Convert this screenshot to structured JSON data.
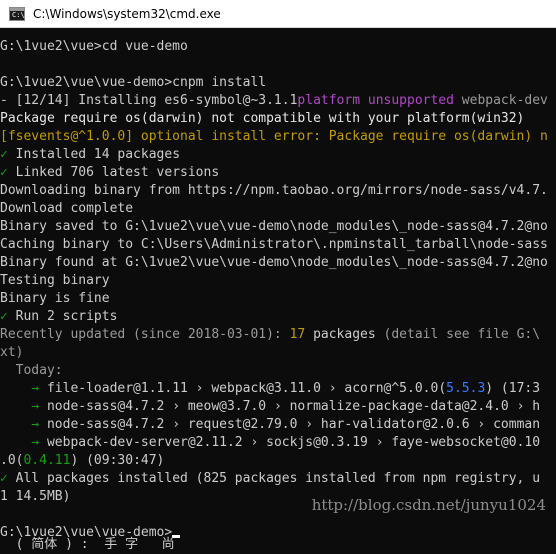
{
  "window": {
    "title": "C:\\Windows\\system32\\cmd.exe",
    "icon": "cmd-icon"
  },
  "console": {
    "lines": [
      {
        "segments": [
          {
            "text": "G:\\1vue2\\vue>cd vue-demo",
            "color": "default"
          }
        ]
      },
      {
        "segments": [
          {
            "text": "",
            "color": "default"
          }
        ]
      },
      {
        "segments": [
          {
            "text": "G:\\1vue2\\vue\\vue-demo>cnpm install",
            "color": "default"
          }
        ]
      },
      {
        "segments": [
          {
            "text": "- [12/14] Installing es6-symbol@~3.1.1",
            "color": "default"
          },
          {
            "text": "platform unsupported",
            "color": "magenta"
          },
          {
            "text": " webpack-dev",
            "color": "gray"
          }
        ]
      },
      {
        "segments": [
          {
            "text": "Package require os(darwin) not compatible with your platform(win32)",
            "color": "white"
          }
        ]
      },
      {
        "segments": [
          {
            "text": "[fsevents@^1.0.0] optional install error: Package require os(darwin) n",
            "color": "yellow"
          }
        ]
      },
      {
        "segments": [
          {
            "text": "✓",
            "color": "green"
          },
          {
            "text": " Installed 14 packages",
            "color": "default"
          }
        ]
      },
      {
        "segments": [
          {
            "text": "✓",
            "color": "green"
          },
          {
            "text": " Linked 706 latest versions",
            "color": "default"
          }
        ]
      },
      {
        "segments": [
          {
            "text": "Downloading binary from https://npm.taobao.org/mirrors/node-sass/v4.7.",
            "color": "default"
          }
        ]
      },
      {
        "segments": [
          {
            "text": "Download complete",
            "color": "default"
          }
        ]
      },
      {
        "segments": [
          {
            "text": "Binary saved to G:\\1vue2\\vue\\vue-demo\\node_modules\\_node-sass@4.7.2@no",
            "color": "default"
          }
        ]
      },
      {
        "segments": [
          {
            "text": "Caching binary to C:\\Users\\Administrator\\.npminstall_tarball\\node-sass",
            "color": "default"
          }
        ]
      },
      {
        "segments": [
          {
            "text": "Binary found at G:\\1vue2\\vue\\vue-demo\\node_modules\\_node-sass@4.7.2@no",
            "color": "default"
          }
        ]
      },
      {
        "segments": [
          {
            "text": "Testing binary",
            "color": "default"
          }
        ]
      },
      {
        "segments": [
          {
            "text": "Binary is fine",
            "color": "default"
          }
        ]
      },
      {
        "segments": [
          {
            "text": "✓",
            "color": "green"
          },
          {
            "text": " Run 2 scripts",
            "color": "default"
          }
        ]
      },
      {
        "segments": [
          {
            "text": "Recently updated (since 2018-03-01): ",
            "color": "gray"
          },
          {
            "text": "17",
            "color": "yellow"
          },
          {
            "text": " packages",
            "color": "default"
          },
          {
            "text": " (detail see file G:\\",
            "color": "gray"
          }
        ]
      },
      {
        "segments": [
          {
            "text": "xt)",
            "color": "gray"
          }
        ]
      },
      {
        "segments": [
          {
            "text": "  Today:",
            "color": "gray"
          }
        ]
      },
      {
        "segments": [
          {
            "text": "    → ",
            "color": "green"
          },
          {
            "text": "file-loader@1.1.11",
            "color": "default"
          },
          {
            "text": " › webpack@3.11.0 › acorn@^5.0.0(",
            "color": "default"
          },
          {
            "text": "5.5.3",
            "color": "blue"
          },
          {
            "text": ") (17:3",
            "color": "default"
          }
        ]
      },
      {
        "segments": [
          {
            "text": "    → ",
            "color": "green"
          },
          {
            "text": "node-sass@4.7.2 › meow@3.7.0 › normalize-package-data@2.4.0 › h",
            "color": "default"
          }
        ]
      },
      {
        "segments": [
          {
            "text": "    → ",
            "color": "green"
          },
          {
            "text": "node-sass@4.7.2 › request@2.79.0 › har-validator@2.0.6 › comman",
            "color": "default"
          }
        ]
      },
      {
        "segments": [
          {
            "text": "    → ",
            "color": "green"
          },
          {
            "text": "webpack-dev-server@2.11.2 › sockjs@0.3.19 › faye-websocket@0.10",
            "color": "default"
          }
        ]
      },
      {
        "segments": [
          {
            "text": ".0(",
            "color": "default"
          },
          {
            "text": "0.4.11",
            "color": "green"
          },
          {
            "text": ") (09:30:47)",
            "color": "default"
          }
        ]
      },
      {
        "segments": [
          {
            "text": "✓",
            "color": "green"
          },
          {
            "text": " All packages installed (825 packages installed from npm registry, u",
            "color": "default"
          }
        ]
      },
      {
        "segments": [
          {
            "text": "1 14.5MB)",
            "color": "default"
          }
        ]
      },
      {
        "segments": [
          {
            "text": "",
            "color": "default"
          }
        ]
      },
      {
        "segments": [
          {
            "text": "G:\\1vue2\\vue\\vue-demo>",
            "color": "default"
          }
        ]
      }
    ],
    "partial_line": "  ( 简体 ) :  手 字   尚  ",
    "watermark": "http://blog.csdn.net/junyu1024"
  },
  "colors": {
    "default": "#cccccc",
    "white": "#e6e6e6",
    "magenta": "#b148c6",
    "yellow": "#c19c00",
    "green": "#13a10e",
    "blue": "#3b78ff",
    "gray": "#9a9a9a"
  }
}
